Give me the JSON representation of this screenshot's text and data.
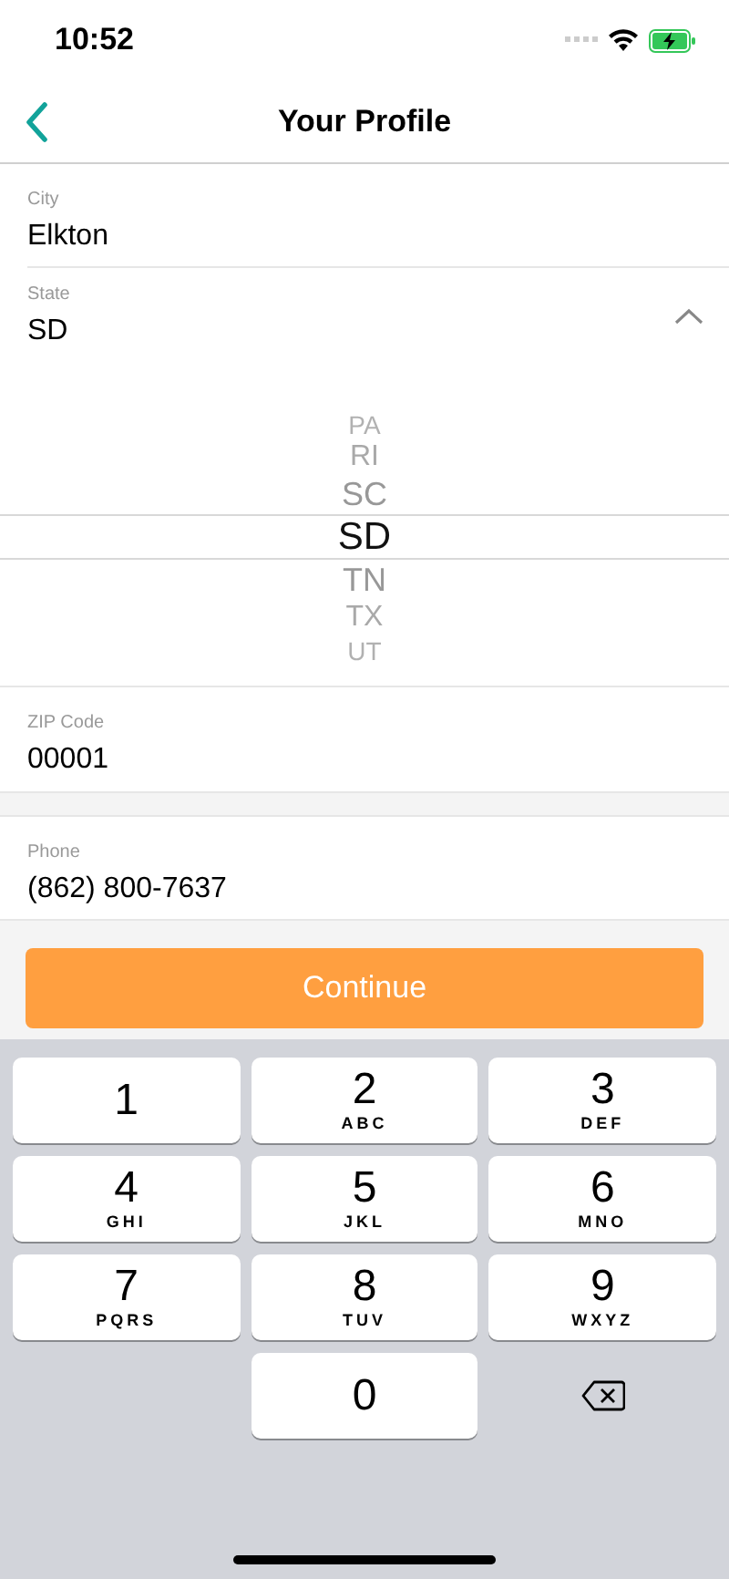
{
  "status_bar": {
    "time": "10:52"
  },
  "nav": {
    "title": "Your Profile"
  },
  "fields_top": [
    {
      "label": "City",
      "value": "Elkton"
    }
  ],
  "state_field": {
    "label": "State",
    "value": "SD",
    "expanded": true
  },
  "picker": [
    {
      "label": "PA",
      "selected": false
    },
    {
      "label": "RI",
      "selected": false
    },
    {
      "label": "SC",
      "selected": false
    },
    {
      "label": "SD",
      "selected": true
    },
    {
      "label": "TN",
      "selected": false
    },
    {
      "label": "TX",
      "selected": false
    },
    {
      "label": "UT",
      "selected": false
    }
  ],
  "zip": {
    "label": "ZIP Code",
    "value": "00001"
  },
  "phone": {
    "label": "Phone",
    "value": "(862) 800-7637"
  },
  "continue_button": {
    "label": "Continue"
  },
  "keypad": [
    {
      "kind": "digit",
      "digit": "1"
    },
    {
      "kind": "digit",
      "digit": "2",
      "letters": "ABC"
    },
    {
      "kind": "digit",
      "digit": "3",
      "letters": "DEF"
    },
    {
      "kind": "digit",
      "digit": "4",
      "letters": "GHI"
    },
    {
      "kind": "digit",
      "digit": "5",
      "letters": "JKL"
    },
    {
      "kind": "digit",
      "digit": "6",
      "letters": "MNO"
    },
    {
      "kind": "digit",
      "digit": "7",
      "letters": "PQRS"
    },
    {
      "kind": "digit",
      "digit": "8",
      "letters": "TUV"
    },
    {
      "kind": "digit",
      "digit": "9",
      "letters": "WXYZ"
    },
    {
      "kind": "blank"
    },
    {
      "kind": "digit",
      "digit": "0"
    },
    {
      "kind": "delete"
    }
  ]
}
